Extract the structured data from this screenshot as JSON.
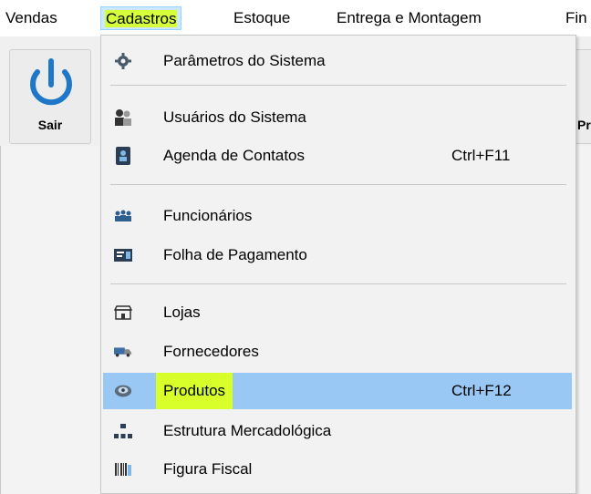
{
  "menubar": {
    "items": [
      "Vendas",
      "Cadastros",
      "Estoque",
      "Entrega e Montagem",
      "Fin"
    ]
  },
  "toolbar": {
    "exit_label": "Sair",
    "next_label_partial": "Pr"
  },
  "dropdown": {
    "items": [
      {
        "label": "Parâmetros do Sistema",
        "shortcut": "",
        "icon": "gear-icon"
      },
      {
        "label": "Usuários do Sistema",
        "shortcut": "",
        "icon": "users-icon"
      },
      {
        "label": "Agenda de Contatos",
        "shortcut": "Ctrl+F11",
        "icon": "contact-book-icon"
      },
      {
        "label": "Funcionários",
        "shortcut": "",
        "icon": "employees-icon"
      },
      {
        "label": "Folha de Pagamento",
        "shortcut": "",
        "icon": "payroll-icon"
      },
      {
        "label": "Lojas",
        "shortcut": "",
        "icon": "store-icon"
      },
      {
        "label": "Fornecedores",
        "shortcut": "",
        "icon": "truck-icon"
      },
      {
        "label": "Produtos",
        "shortcut": "Ctrl+F12",
        "icon": "products-icon"
      },
      {
        "label": "Estrutura Mercadológica",
        "shortcut": "",
        "icon": "hierarchy-icon"
      },
      {
        "label": "Figura Fiscal",
        "shortcut": "",
        "icon": "barcode-icon"
      }
    ]
  },
  "colors": {
    "highlight": "#98c8f3",
    "marker": "#d8ff2a",
    "power_icon": "#1f77c8"
  }
}
